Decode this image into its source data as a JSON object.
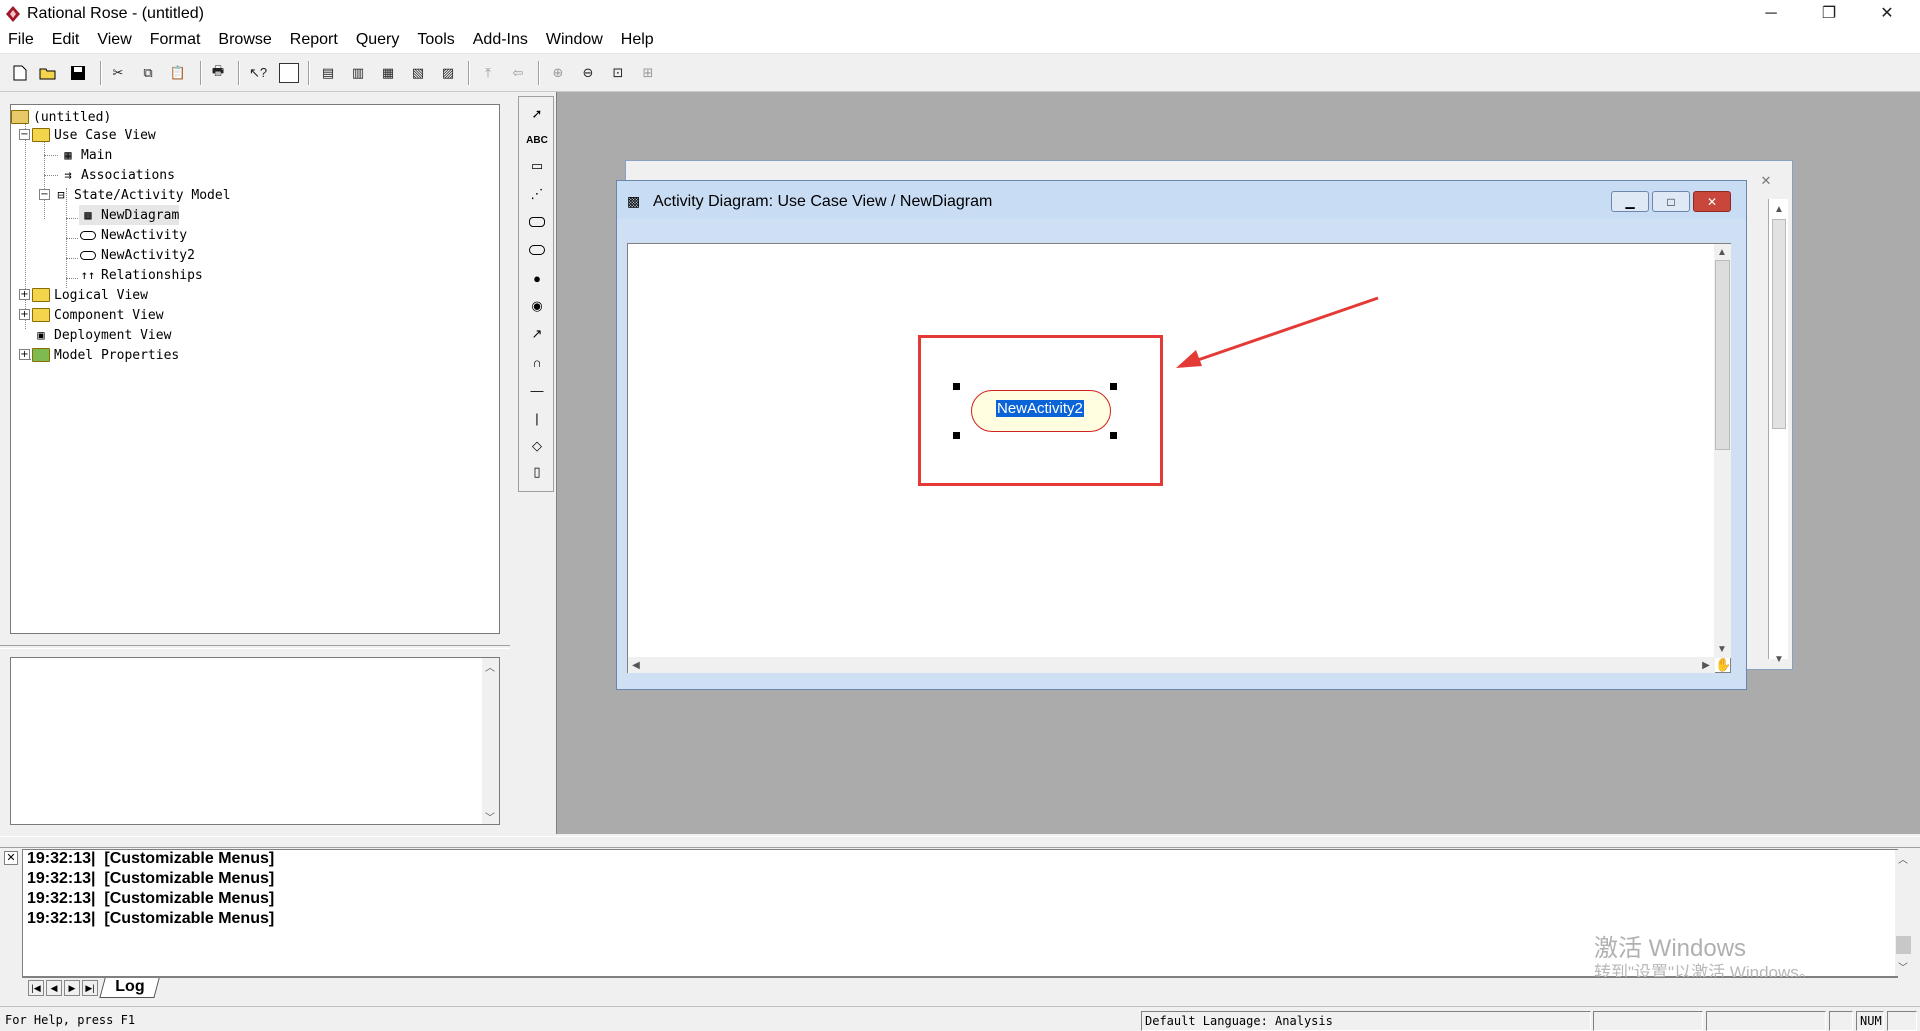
{
  "app": {
    "title": "Rational Rose - (untitled)"
  },
  "window_controls": {
    "minimize": "─",
    "restore": "❐",
    "close": "✕"
  },
  "menu": [
    "File",
    "Edit",
    "View",
    "Format",
    "Browse",
    "Report",
    "Query",
    "Tools",
    "Add-Ins",
    "Window",
    "Help"
  ],
  "tree": {
    "root": "(untitled)",
    "use_case_view": "Use Case View",
    "main": "Main",
    "associations": "Associations",
    "state_activity_model": "State/Activity Model",
    "new_diagram": "NewDiagram",
    "new_activity": "NewActivity",
    "new_activity2": "NewActivity2",
    "relationships": "Relationships",
    "logical_view": "Logical View",
    "component_view": "Component View",
    "deployment_view": "Deployment View",
    "model_properties": "Model Properties"
  },
  "palette": {
    "text_tool": "ABC"
  },
  "diagram": {
    "title": "Activity Diagram: Use Case View / NewDiagram",
    "activity_label": "NewActivity2"
  },
  "log": {
    "lines": [
      "19:32:13|  [Customizable Menus]",
      "19:32:13|  [Customizable Menus]",
      "19:32:13|  [Customizable Menus]",
      "19:32:13|  [Customizable Menus]"
    ],
    "tab": "Log"
  },
  "watermark": {
    "line1": "激活 Windows",
    "line2": "转到\"设置\"以激活 Windows。"
  },
  "status": {
    "help": "For Help, press F1",
    "language": "Default Language: Analysis",
    "num": "NUM"
  },
  "colors": {
    "highlight": "#e53935",
    "selection": "#0a64d8",
    "activity_fill": "#fffee0"
  }
}
